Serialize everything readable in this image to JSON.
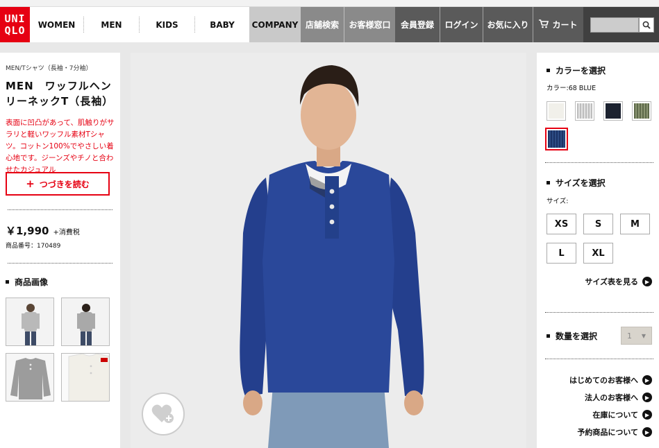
{
  "header": {
    "logo_line1": "UNI",
    "logo_line2": "QLO",
    "nav_main": [
      "WOMEN",
      "MEN",
      "KIDS",
      "BABY"
    ],
    "company": "COMPANY",
    "nav_gray": [
      "店舗検索",
      "お客様窓口"
    ],
    "nav_dark": [
      "会員登録",
      "ログイン",
      "お気に入り",
      "カート"
    ],
    "search_placeholder": ""
  },
  "left": {
    "breadcrumb": "MEN/Tシャツ（長袖・7分袖）",
    "title": "MEN　ワッフルヘンリーネックT（長袖）",
    "description": "表面に凹凸があって、肌触りがサラリと軽いワッフル素材Tシャツ。コットン100%でやさしい着心地です。ジーンズやチノと合わせたカジュアル",
    "read_more": "つづきを読む",
    "price": "￥1,990",
    "tax": "+消費税",
    "product_code": "商品番号：170489",
    "images_heading": "商品画像"
  },
  "right": {
    "color_heading": "カラーを選択",
    "color_selected": "カラー:68 BLUE",
    "colors": [
      "#f1f0ea",
      "#cfcfcf",
      "#1c2230",
      "#6b7558",
      "#203a6a"
    ],
    "size_heading": "サイズを選択",
    "size_label": "サイズ:",
    "sizes": [
      "XS",
      "S",
      "M",
      "L",
      "XL"
    ],
    "size_chart_link": "サイズ表を見る",
    "qty_heading": "数量を選択",
    "qty_value": "1",
    "links": [
      "はじめてのお客様へ",
      "法人のお客様へ",
      "在庫について",
      "予約商品について"
    ]
  }
}
